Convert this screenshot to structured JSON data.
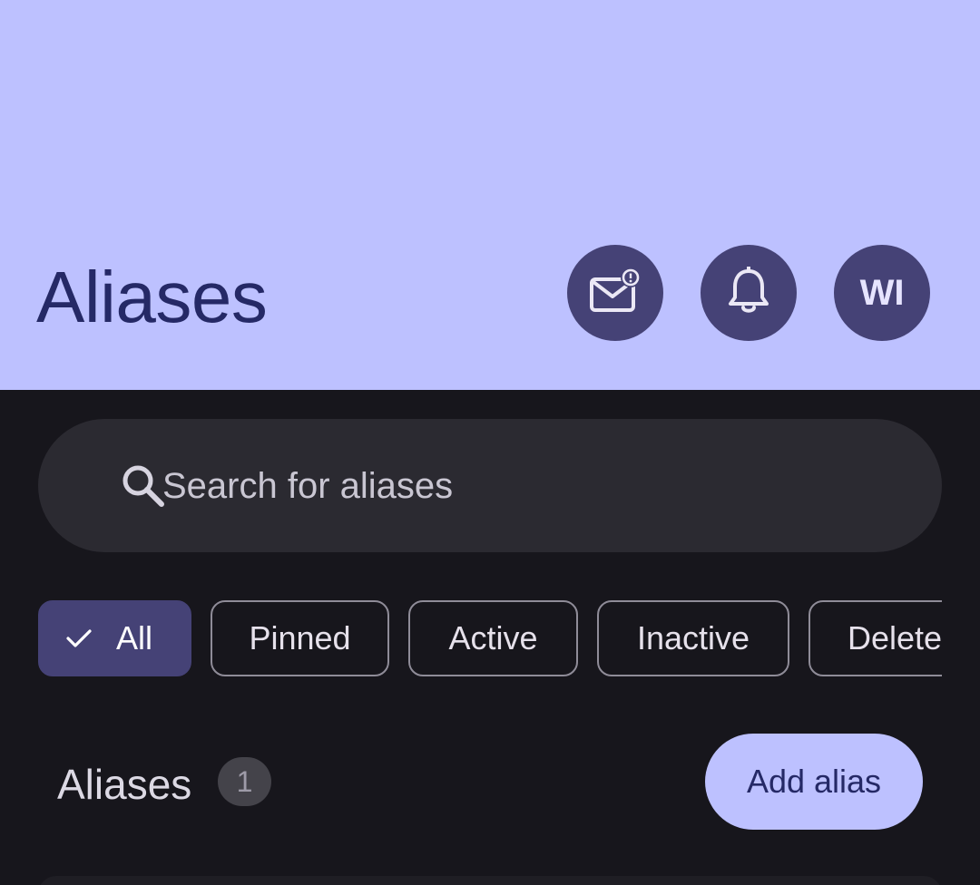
{
  "header": {
    "title": "Aliases",
    "avatar_initials": "WI",
    "mail_icon": "mail-alert-icon",
    "bell_icon": "bell-icon"
  },
  "search": {
    "placeholder": "Search for aliases",
    "icon": "search-icon"
  },
  "filters": [
    {
      "label": "All",
      "selected": true
    },
    {
      "label": "Pinned",
      "selected": false
    },
    {
      "label": "Active",
      "selected": false
    },
    {
      "label": "Inactive",
      "selected": false
    },
    {
      "label": "Delete",
      "selected": false
    }
  ],
  "list": {
    "section_title": "Aliases",
    "count": "1",
    "add_label": "Add alias"
  },
  "colors": {
    "header_bg": "#bdc1ff",
    "accent_dark": "#454276",
    "title_color": "#252966",
    "body_bg": "#17161c"
  }
}
